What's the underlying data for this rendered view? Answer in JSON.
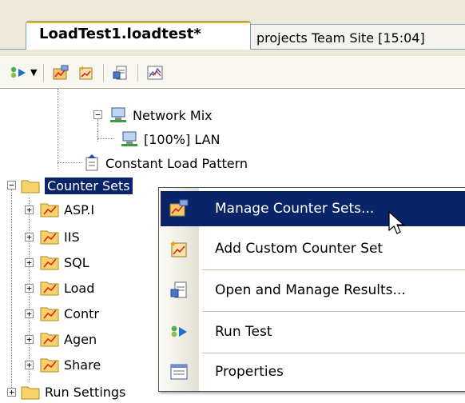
{
  "tabs": [
    {
      "label": "LoadTest1.loadtest*",
      "active": true
    },
    {
      "label": "projects Team Site [15:04]",
      "active": false
    }
  ],
  "toolbar": {
    "buttons": [
      "run-test-icon",
      "manage-counter-sets-icon",
      "add-custom-counter-set-icon",
      "open-manage-results-icon",
      "properties-icon"
    ]
  },
  "tree": {
    "network_mix": "Network Mix",
    "lan": "[100%] LAN",
    "load_pattern": "Constant Load Pattern",
    "counter_sets": "Counter Sets",
    "children": [
      "ASP.I",
      "IIS",
      "SQL",
      "Load",
      "Contr",
      "Agen",
      "Share"
    ],
    "run_settings": "Run Settings"
  },
  "context_menu": {
    "items": [
      {
        "label": "Manage Counter Sets...",
        "icon": "manage-counter-sets-icon",
        "highlighted": true
      },
      {
        "label": "Add Custom Counter Set",
        "icon": "add-custom-counter-set-icon",
        "highlighted": false
      },
      {
        "label": "Open and Manage Results...",
        "icon": "open-manage-results-icon",
        "highlighted": false
      },
      {
        "label": "Run Test",
        "icon": "run-test-icon",
        "highlighted": false
      },
      {
        "label": "Properties",
        "icon": "properties-icon",
        "highlighted": false
      }
    ]
  },
  "colors": {
    "selection": "#0a246a",
    "chrome": "#ece9d8",
    "tab_accent": "#f0b400"
  }
}
